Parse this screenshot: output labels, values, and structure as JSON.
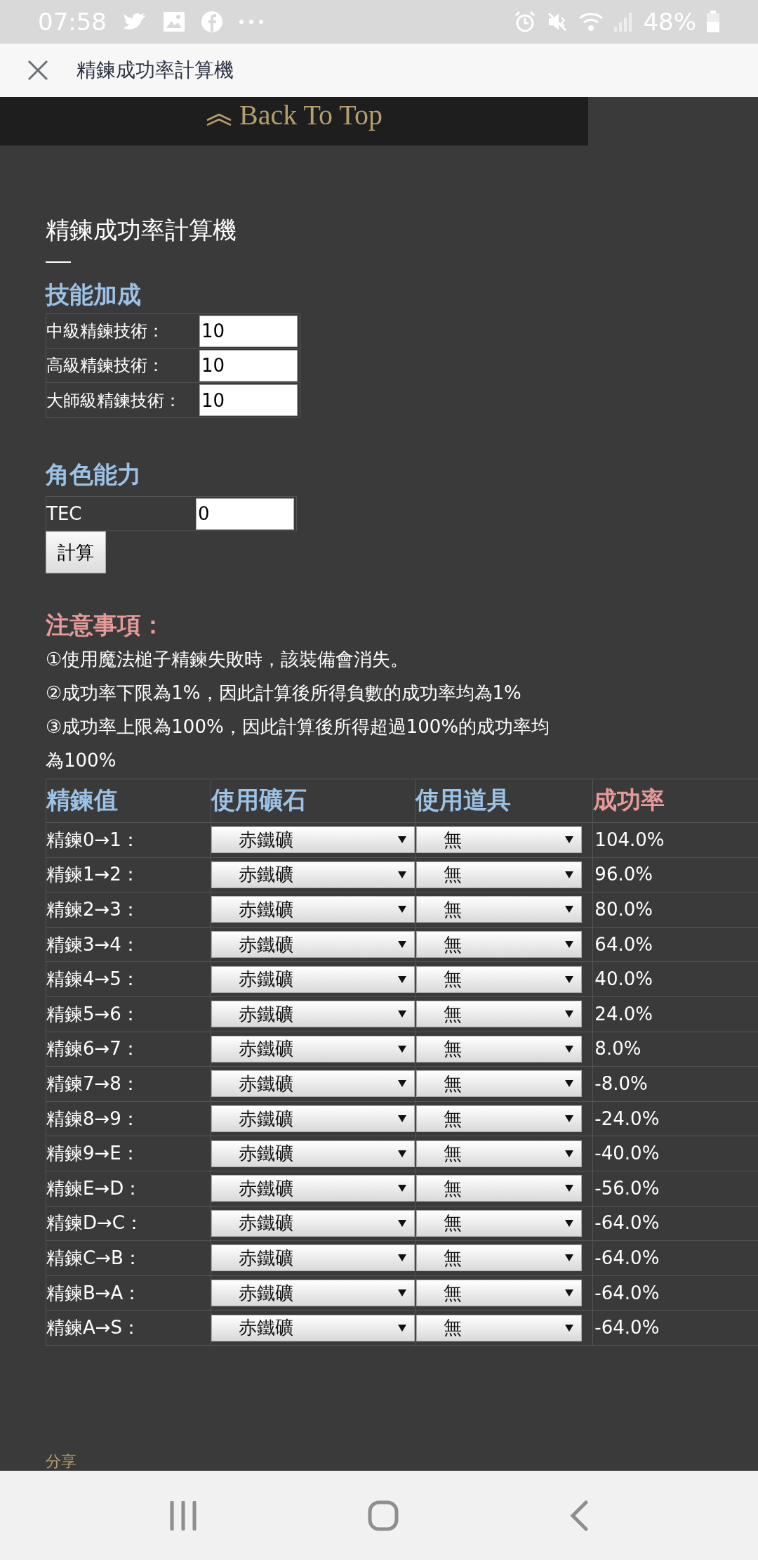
{
  "status_bar": {
    "time": "07:58",
    "battery": "48%"
  },
  "app_bar": {
    "title": "精鍊成功率計算機"
  },
  "back_to_top": {
    "label": "Back To Top"
  },
  "page_title": "精鍊成功率計算機",
  "skills": {
    "heading": "技能加成",
    "rows": [
      {
        "label": "中級精鍊技術：",
        "value": "10"
      },
      {
        "label": "高級精鍊技術：",
        "value": "10"
      },
      {
        "label": "大師級精鍊技術：",
        "value": "10"
      }
    ]
  },
  "stats": {
    "heading": "角色能力",
    "rows": [
      {
        "label": "TEC",
        "value": "0"
      }
    ],
    "button": "計算"
  },
  "notes": {
    "heading": "注意事項：",
    "lines": [
      "①使用魔法槌子精鍊失敗時，該裝備會消失。",
      "②成功率下限為1%，因此計算後所得負數的成功率均為1%",
      "③成功率上限為100%，因此計算後所得超過100%的成功率均為100%"
    ]
  },
  "table": {
    "columns": [
      "精鍊值",
      "使用礦石",
      "使用道具",
      "成功率"
    ],
    "rows": [
      {
        "label": "精鍊0→1：",
        "ore": "赤鐵礦",
        "item": "無",
        "rate": "104.0%"
      },
      {
        "label": "精鍊1→2：",
        "ore": "赤鐵礦",
        "item": "無",
        "rate": "96.0%"
      },
      {
        "label": "精鍊2→3：",
        "ore": "赤鐵礦",
        "item": "無",
        "rate": "80.0%"
      },
      {
        "label": "精鍊3→4：",
        "ore": "赤鐵礦",
        "item": "無",
        "rate": "64.0%"
      },
      {
        "label": "精鍊4→5：",
        "ore": "赤鐵礦",
        "item": "無",
        "rate": "40.0%"
      },
      {
        "label": "精鍊5→6：",
        "ore": "赤鐵礦",
        "item": "無",
        "rate": "24.0%"
      },
      {
        "label": "精鍊6→7：",
        "ore": "赤鐵礦",
        "item": "無",
        "rate": "8.0%"
      },
      {
        "label": "精鍊7→8：",
        "ore": "赤鐵礦",
        "item": "無",
        "rate": "-8.0%"
      },
      {
        "label": "精鍊8→9：",
        "ore": "赤鐵礦",
        "item": "無",
        "rate": "-24.0%"
      },
      {
        "label": "精鍊9→E：",
        "ore": "赤鐵礦",
        "item": "無",
        "rate": "-40.0%"
      },
      {
        "label": "精鍊E→D：",
        "ore": "赤鐵礦",
        "item": "無",
        "rate": "-56.0%"
      },
      {
        "label": "精鍊D→C：",
        "ore": "赤鐵礦",
        "item": "無",
        "rate": "-64.0%"
      },
      {
        "label": "精鍊C→B：",
        "ore": "赤鐵礦",
        "item": "無",
        "rate": "-64.0%"
      },
      {
        "label": "精鍊B→A：",
        "ore": "赤鐵礦",
        "item": "無",
        "rate": "-64.0%"
      },
      {
        "label": "精鍊A→S：",
        "ore": "赤鐵礦",
        "item": "無",
        "rate": "-64.0%"
      }
    ]
  },
  "share": "分享"
}
